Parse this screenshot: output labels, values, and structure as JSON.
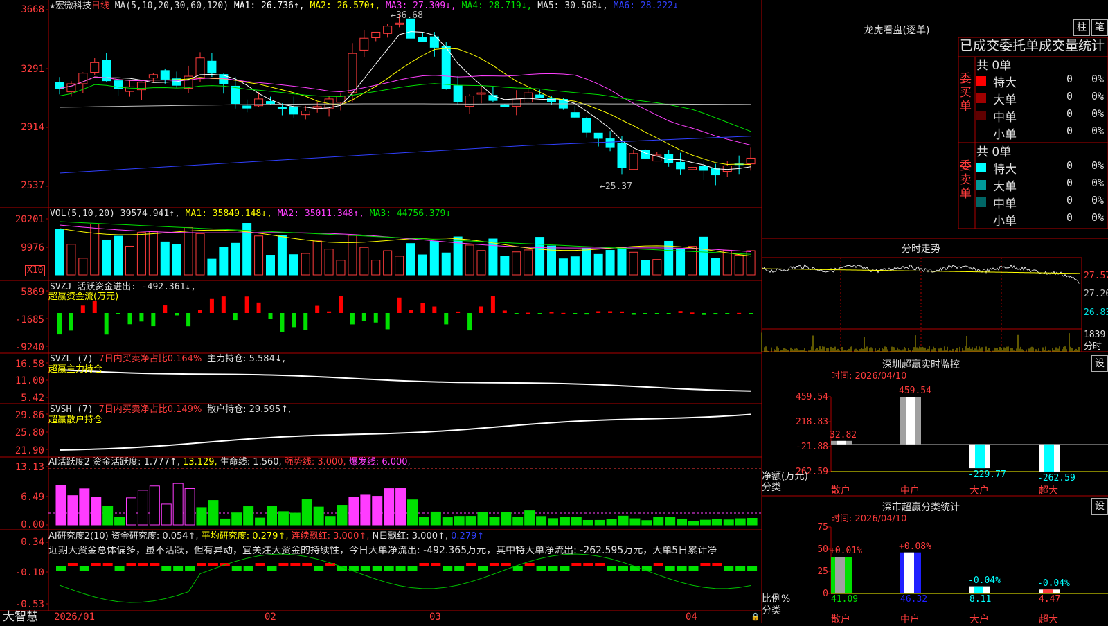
{
  "header": {
    "star": "★",
    "stock_name": "宏微科技",
    "period": "日线",
    "ma_params": "MA(5,10,20,30,60,120)",
    "ma1": "MA1: 26.736↑,",
    "ma2": "MA2: 26.570↑,",
    "ma3": "MA3: 27.309↓,",
    "ma4": "MA4: 28.719↓,",
    "ma5": "MA5: 30.508↓,",
    "ma6": "MA6: 28.222↓"
  },
  "main_axis": [
    "3668",
    "3291",
    "2914",
    "2537"
  ],
  "main_annotations": {
    "high": "36.68",
    "low": "25.37"
  },
  "vol": {
    "label": "VOL(5,10,20)",
    "value": "39574.941↑,",
    "ma1": "MA1: 35849.148↓,",
    "ma2": "MA2: 35011.348↑,",
    "ma3": "MA3: 44756.379↓",
    "axis": [
      "20201",
      "9976"
    ],
    "unit": "X10"
  },
  "svzj": {
    "label": "SVZJ  活跃资金进出: -492.361↓,",
    "sub": "超赢资金流(万元)",
    "axis": [
      "5869",
      "-1685",
      "-9240"
    ]
  },
  "svzl": {
    "label": "SVZL (7)",
    "red": "7日内买卖净占比0.164%",
    "hold": "主力持仓: 5.584↓,",
    "sub": "超赢主力持仓",
    "axis": [
      "16.58",
      "11.00",
      "5.42"
    ]
  },
  "svsh": {
    "label": "SVSH (7)",
    "red": "7日内买卖净占比0.149%",
    "hold": "散户持仓: 29.595↑,",
    "sub": "超赢散户持仓",
    "axis": [
      "29.86",
      "25.80",
      "21.90"
    ]
  },
  "ai1": {
    "label": "AI活跃度2 资金活跃度: 1.777↑,",
    "v2": "13.129,",
    "life": "生命线: 1.560,",
    "strong": "强势线: 3.000,",
    "burst": "爆发线: 6.000,",
    "axis": [
      "13.13",
      "6.49",
      "0.00"
    ]
  },
  "ai2": {
    "label": "AI研究度2(10) 资金研究度: 0.054↑,",
    "avg": "平均研究度: 0.279↑,",
    "cont": "连续飘红: 3.000↑,",
    "n": "N日飘红: 3.000↑,",
    "last": "0.279↑",
    "desc": "近期大资金总体偏多，虽不活跃，但有异动，宜关注大资金的持续性，今日大单净流出: -492.365万元，其中特大单净流出: -262.595万元，大单5日累计净",
    "axis": [
      "0.34",
      "-0.10",
      "-0.53"
    ]
  },
  "xaxis": [
    "2026/01",
    "02",
    "03",
    "04"
  ],
  "brand": "大智慧",
  "dragon": {
    "title": "龙虎看盘(逐单)",
    "btn_zhu": "柱",
    "btn_bi": "笔",
    "subtitle": "已成交委托单成交量统计",
    "buy_side": "委买单",
    "sell_side": "委卖单",
    "buy_total": "共 0单",
    "sell_total": "共 0单",
    "buy_rows": [
      {
        "name": "特大",
        "count": "0",
        "pct": "0%",
        "color": "#ff0000"
      },
      {
        "name": "大单",
        "count": "0",
        "pct": "0%",
        "color": "#a00000"
      },
      {
        "name": "中单",
        "count": "0",
        "pct": "0%",
        "color": "#600000"
      },
      {
        "name": "小单",
        "count": "0",
        "pct": "0%",
        "color": ""
      }
    ],
    "sell_rows": [
      {
        "name": "特大",
        "count": "0",
        "pct": "0%",
        "color": "#00ffff"
      },
      {
        "name": "大单",
        "count": "0",
        "pct": "0%",
        "color": "#009999"
      },
      {
        "name": "中单",
        "count": "0",
        "pct": "0%",
        "color": "#006666"
      },
      {
        "name": "小单",
        "count": "0",
        "pct": "0%",
        "color": ""
      }
    ]
  },
  "intraday": {
    "title": "分时走势",
    "axis": [
      "27.57",
      "27.20",
      "26.83"
    ],
    "vol_value": "1839",
    "vol_unit": "分时"
  },
  "monitor": {
    "title": "深圳超赢实时监控",
    "btn": "设",
    "time": "时间: 2026/04/10",
    "axis": [
      "459.54",
      "218.83",
      "-21.88",
      "-262.59"
    ],
    "ylabel": "净额(万元)",
    "xlabel": "分类",
    "categories": [
      "散户",
      "中户",
      "大户",
      "超大"
    ],
    "values": [
      "32.82",
      "459.54",
      "-229.77",
      "-262.59"
    ]
  },
  "classify": {
    "title": "深市超赢分类统计",
    "btn": "设",
    "time": "时间: 2026/04/10",
    "axis": [
      "75",
      "50",
      "25",
      "0"
    ],
    "ylabel": "比例%",
    "xlabel": "分类",
    "categories": [
      "散户",
      "中户",
      "大户",
      "超大"
    ],
    "values": [
      "41.09",
      "46.32",
      "8.11",
      "4.47"
    ],
    "changes": [
      "+0.01%",
      "+0.08%",
      "-0.04%",
      "-0.04%"
    ]
  },
  "chart_data": [
    {
      "type": "bar",
      "title": "深圳超赢实时监控",
      "categories": [
        "散户",
        "中户",
        "大户",
        "超大"
      ],
      "values": [
        32.82,
        459.54,
        -229.77,
        -262.59
      ],
      "ylabel": "净额(万元)",
      "xlabel": "分类",
      "ylim": [
        -262.59,
        459.54
      ]
    },
    {
      "type": "bar",
      "title": "深市超赢分类统计",
      "categories": [
        "散户",
        "中户",
        "大户",
        "超大"
      ],
      "values": [
        41.09,
        46.32,
        8.11,
        4.47
      ],
      "ylabel": "比例%",
      "xlabel": "分类",
      "ylim": [
        0,
        75
      ]
    }
  ]
}
